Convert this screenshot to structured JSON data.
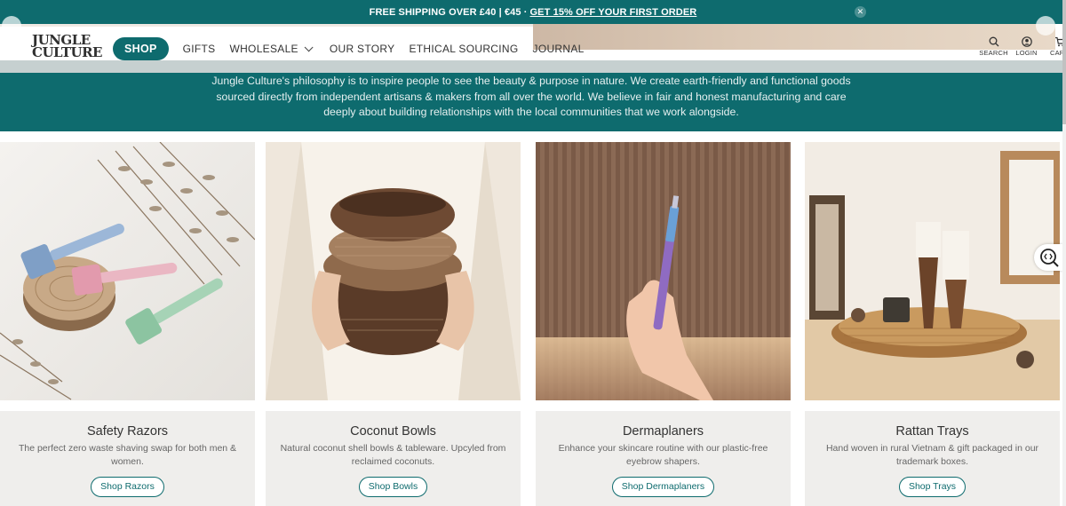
{
  "announcement": {
    "text": "FREE SHIPPING OVER £40 | €45 ·",
    "link": "GET 15% OFF YOUR FIRST ORDER"
  },
  "logo": {
    "line1": "JUNGLE",
    "line2": "CULTURE"
  },
  "nav": {
    "shop": "SHOP",
    "gifts": "GIFTS",
    "wholesale": "WHOLESALE",
    "our_story": "OUR STORY",
    "ethical_sourcing": "ETHICAL SOURCING",
    "journal": "JOURNAL"
  },
  "utils": {
    "search": "SEARCH",
    "login": "LOGIN",
    "cart": "CART"
  },
  "philosophy": "Jungle Culture's philosophy is to inspire people to see the beauty & purpose in nature. We create earth-friendly and functional goods sourced directly from independent artisans & makers from all over the world. We believe in fair and honest manufacturing and care deeply about building relationships with the local communities that we work alongside.",
  "products": [
    {
      "title": "Safety Razors",
      "desc": "The perfect zero waste shaving swap for both men & women.",
      "button": "Shop Razors"
    },
    {
      "title": "Coconut Bowls",
      "desc": "Natural coconut shell bowls & tableware. Upcyled from reclaimed coconuts.",
      "button": "Shop Bowls"
    },
    {
      "title": "Dermaplaners",
      "desc": "Enhance your skincare routine with our plastic-free eyebrow shapers.",
      "button": "Shop Dermaplaners"
    },
    {
      "title": "Rattan Trays",
      "desc": "Hand woven in rural Vietnam & gift packaged in our trademark boxes.",
      "button": "Shop Trays"
    }
  ],
  "colors": {
    "brand": "#0e6b6e",
    "card_bg": "#efeeec"
  },
  "icons": {
    "search": "search-icon",
    "login": "user-icon",
    "cart": "cart-icon",
    "close": "close-icon",
    "zoom": "zoom-icon"
  }
}
